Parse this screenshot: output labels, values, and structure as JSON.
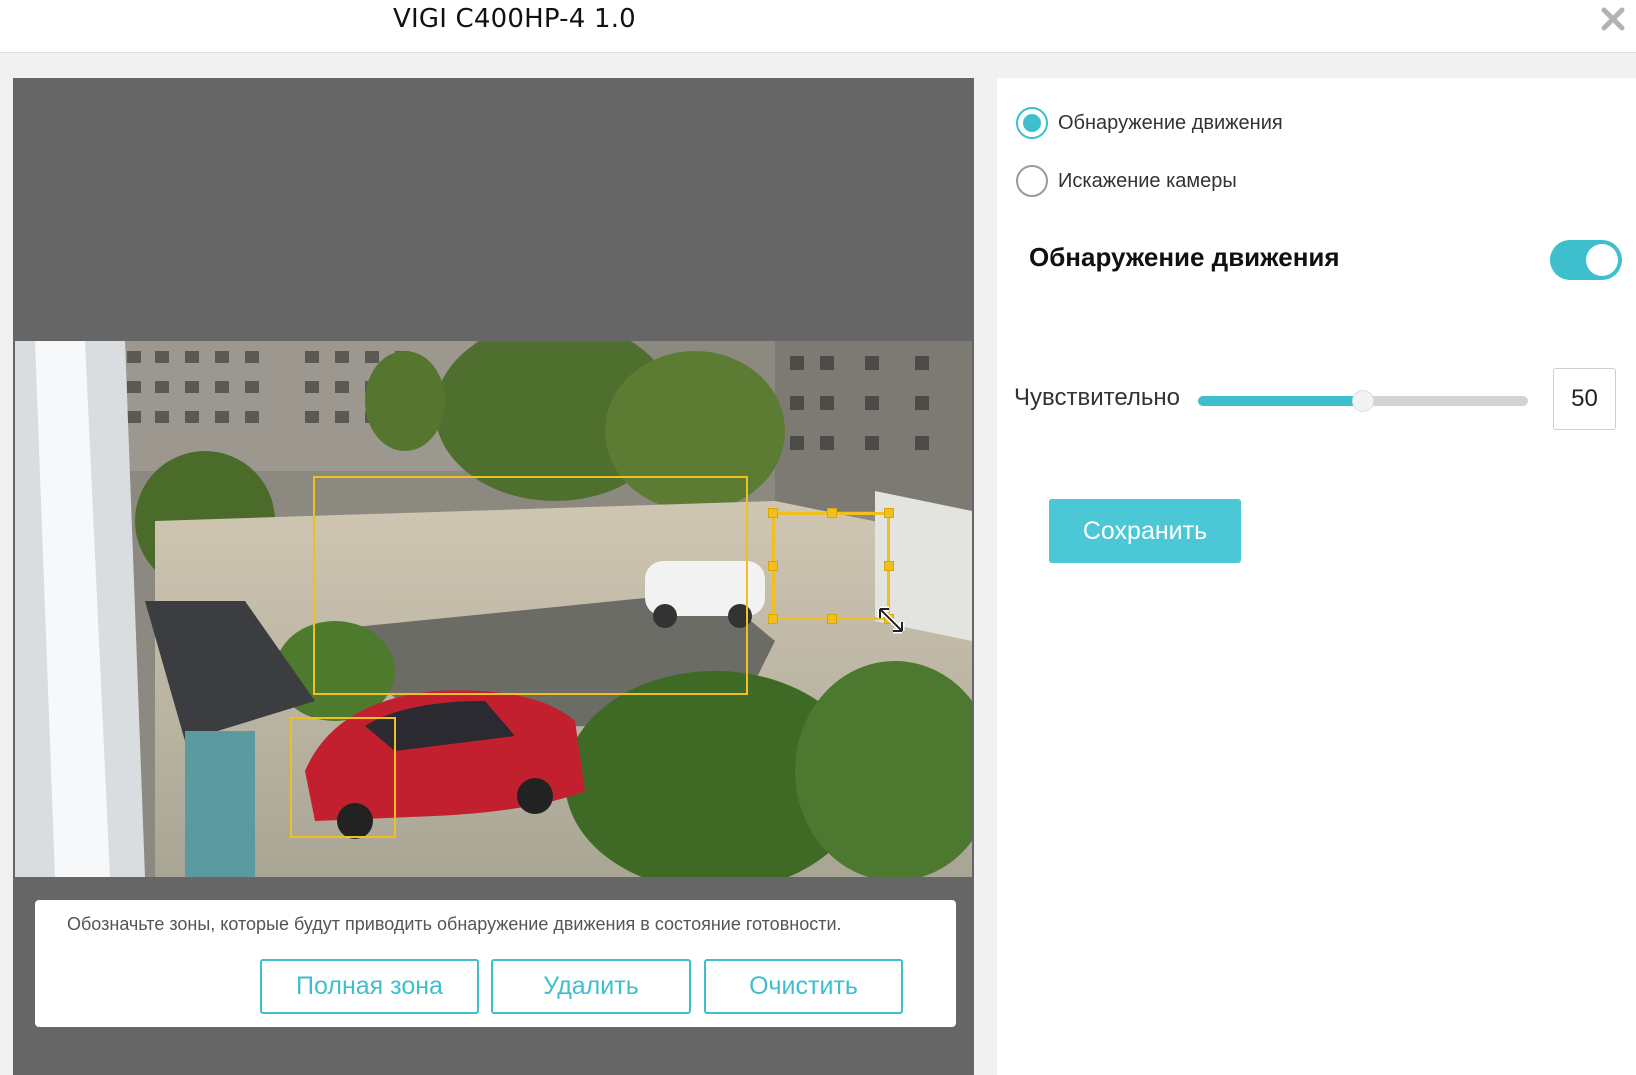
{
  "window": {
    "title": "VIGI C400HP-4 1.0",
    "close_icon": "close-icon"
  },
  "camera": {
    "zones": [
      {
        "name": "motion-zone-1",
        "selected": false
      },
      {
        "name": "motion-zone-2",
        "selected": false
      },
      {
        "name": "motion-zone-3",
        "selected": true
      }
    ]
  },
  "hint": {
    "text": "Обозначьте зоны, которые будут приводить обнаружение движения в состояние готовности.",
    "buttons": {
      "full_zone": "Полная зона",
      "delete": "Удалить",
      "clear": "Очистить"
    }
  },
  "detection_type": {
    "options": [
      {
        "label": "Обнаружение движения",
        "checked": true
      },
      {
        "label": "Искажение камеры",
        "checked": false
      }
    ]
  },
  "motion": {
    "title": "Обнаружение движения",
    "enabled": true
  },
  "sensitivity": {
    "label": "Чувствительность",
    "value": "50",
    "value_fraction": 0.5
  },
  "actions": {
    "save": "Сохранить"
  },
  "colors": {
    "accent": "#3ebfce",
    "zone": "#f0c020",
    "panel_dark": "#666666"
  }
}
